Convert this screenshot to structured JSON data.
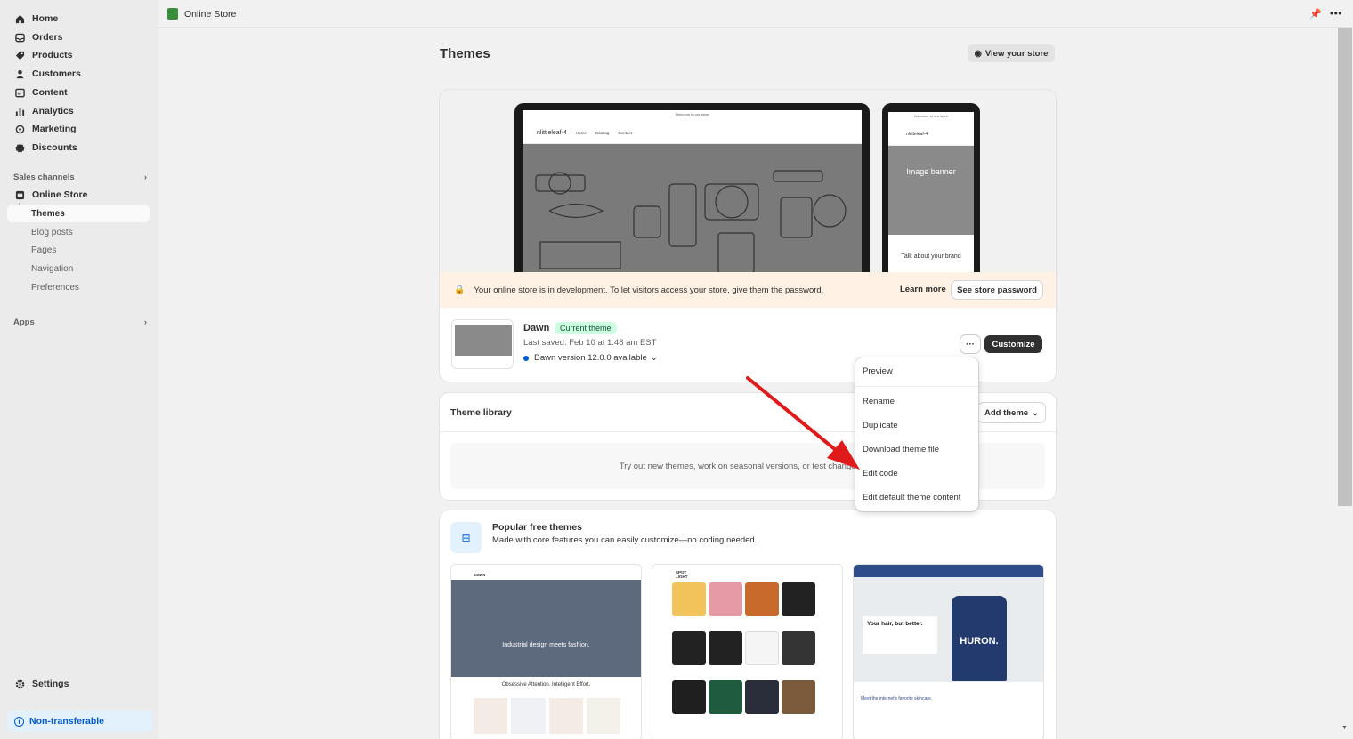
{
  "sidebar": {
    "items": [
      {
        "label": "Home",
        "icon": "home-icon"
      },
      {
        "label": "Orders",
        "icon": "inbox-icon"
      },
      {
        "label": "Products",
        "icon": "tag-icon"
      },
      {
        "label": "Customers",
        "icon": "person-icon"
      },
      {
        "label": "Content",
        "icon": "content-icon"
      },
      {
        "label": "Analytics",
        "icon": "bar-chart-icon"
      },
      {
        "label": "Marketing",
        "icon": "target-icon"
      },
      {
        "label": "Discounts",
        "icon": "discount-icon"
      }
    ],
    "sales_channels_label": "Sales channels",
    "online_store_label": "Online Store",
    "sub_items": [
      "Themes",
      "Blog posts",
      "Pages",
      "Navigation",
      "Preferences"
    ],
    "apps_label": "Apps",
    "settings_label": "Settings",
    "non_transferable_label": "Non-transferable"
  },
  "topbar": {
    "title": "Online Store"
  },
  "page": {
    "title": "Themes",
    "view_store_label": "View your store"
  },
  "current_theme": {
    "preview": {
      "desktop_header": "Welcome to our store",
      "store_name": "nlittleleaf-4",
      "nav_links": [
        "Home",
        "Catalog",
        "Contact"
      ],
      "mobile_header": "Welcome to our store",
      "mobile_banner_title": "Image banner",
      "mobile_talk": "Talk about your brand"
    },
    "dev_banner": {
      "text": "Your online store is in development. To let visitors access your store, give them the password.",
      "learn_more": "Learn more",
      "see_password": "See store password"
    },
    "name": "Dawn",
    "badge": "Current theme",
    "last_saved": "Last saved: Feb 10 at 1:48 am EST",
    "version": "Dawn version 12.0.0 available",
    "customize_label": "Customize"
  },
  "menu": {
    "items": [
      "Preview",
      "Rename",
      "Duplicate",
      "Download theme file",
      "Edit code",
      "Edit default theme content"
    ]
  },
  "theme_library": {
    "title": "Theme library",
    "add_theme_label": "Add theme",
    "empty_text": "Try out new themes, work on seasonal versions, or test changes to y"
  },
  "popular": {
    "title": "Popular free themes",
    "subtitle": "Made with core features you can easily customize—no coding needed.",
    "cards": [
      {
        "logo": "DAWN",
        "hero_text": "Industrial design meets fashion.",
        "tagline": "Obsessive Attention. Intelligent Effort."
      },
      {
        "logo": "SPOT LIGHT"
      },
      {
        "logo": "REFRESH",
        "hero_text": "Your hair, but better.",
        "bottle_text": "HURON.",
        "meet_text": "Meet the internet's favorite skincare."
      }
    ]
  },
  "colors": {
    "accent": "#005bd3",
    "badge_bg": "#cdfee1",
    "banner_bg": "#fff1e3",
    "arrow": "#e01a1a"
  }
}
